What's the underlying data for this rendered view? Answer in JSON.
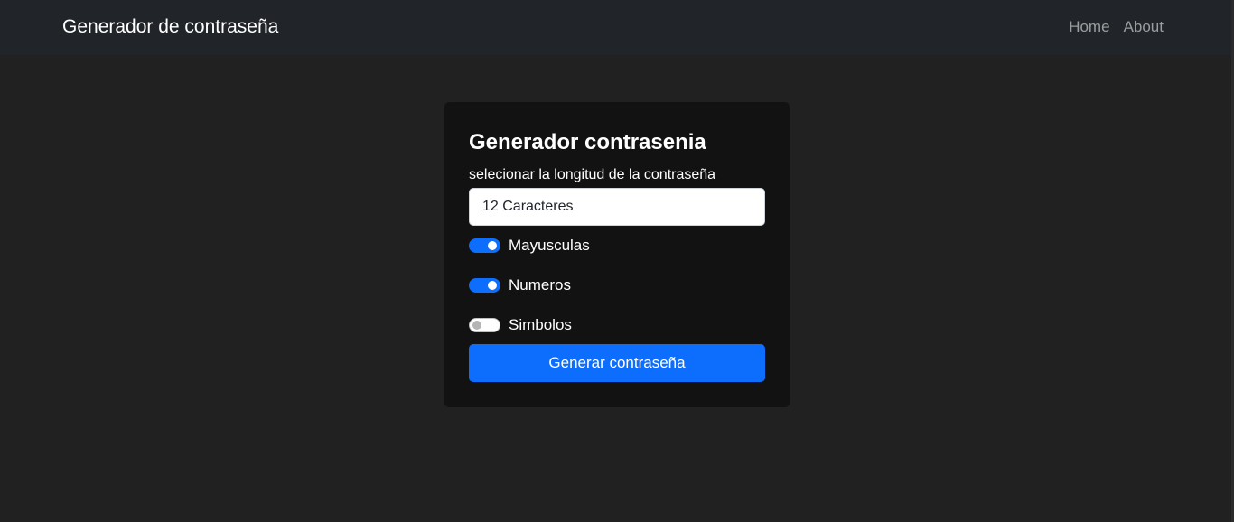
{
  "navbar": {
    "brand": "Generador de contraseña",
    "links": [
      "Home",
      "About"
    ]
  },
  "card": {
    "title": "Generador contrasenia",
    "length_label": "selecionar la longitud de la contraseña",
    "length_value": "12 Caracteres",
    "options": [
      {
        "label": "Mayusculas",
        "checked": true
      },
      {
        "label": "Numeros",
        "checked": true
      },
      {
        "label": "Simbolos",
        "checked": false
      }
    ],
    "generate_label": "Generar contraseña"
  },
  "colors": {
    "page_bg": "#212121",
    "navbar_bg": "#212529",
    "card_bg": "#121212",
    "accent": "#0d6efd"
  }
}
